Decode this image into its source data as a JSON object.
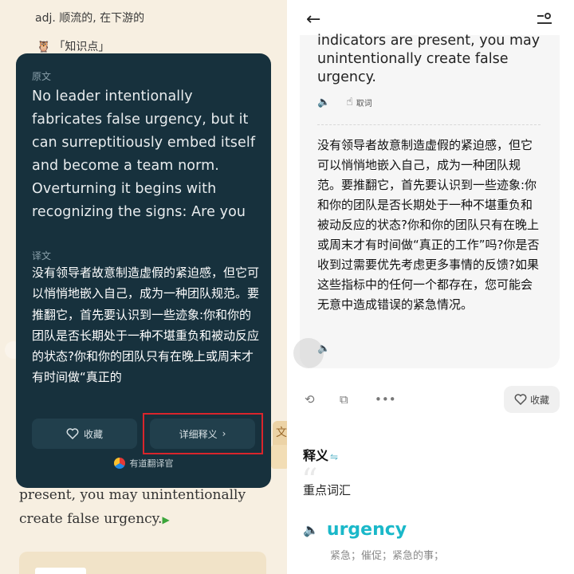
{
  "left": {
    "top_definition": "adj. 顺流的, 在下游的",
    "knowledge_label": "「知识点」",
    "popup": {
      "original_label": "原文",
      "original_text": "No leader intentionally fabricates false urgency, but it can surreptitiously embed itself and become a team norm. Overturning it begins with recognizing the signs: Are you",
      "translation_label": "译文",
      "translation_text": "没有领导者故意制造虚假的紧迫感，但它可以悄悄地嵌入自己，成为一种团队规范。要推翻它，首先要认识到一些迹象:你和你的团队是否长期处于一种不堪重负和被动反应的状态?你和你的团队只有在晚上或周末才有时间做“真正的",
      "favorite_label": "收藏",
      "detail_label": "详细释义",
      "brand_label": "有道翻译官"
    },
    "under_text": "present, you may unintentionally create false urgency."
  },
  "right": {
    "english_tail": "indicators are present, you may unintentionally create false urgency.",
    "cancel_label": "取词",
    "chinese_text": "没有领导者故意制造虚假的紧迫感，但它可以悄悄地嵌入自己，成为一种团队规范。要推翻它，首先要认识到一些迹象:你和你的团队是否长期处于一种不堪重负和被动反应的状态?你和你的团队只有在晚上或周末才有时间做“真正的工作”吗?你是否收到过需要优先考虑更多事情的反馈?如果这些指标中的任何一个都存在，您可能会无意中造成错误的紧急情况。",
    "favorite_label": "收藏",
    "section_title": "释义",
    "vocab_heading": "重点词汇",
    "word": "urgency",
    "word_meaning": "紧急；催促；紧急的事；"
  },
  "icons": {
    "back": "back-arrow-icon",
    "menu": "settings-sliders-icon",
    "speaker": "speaker-icon",
    "finger": "finger-tap-icon",
    "heart": "heart-icon",
    "chevron": "chevron-right-icon"
  },
  "colors": {
    "popup_bg": "#17313d",
    "accent": "#1ab8c9",
    "highlight_box": "#d9252c"
  }
}
